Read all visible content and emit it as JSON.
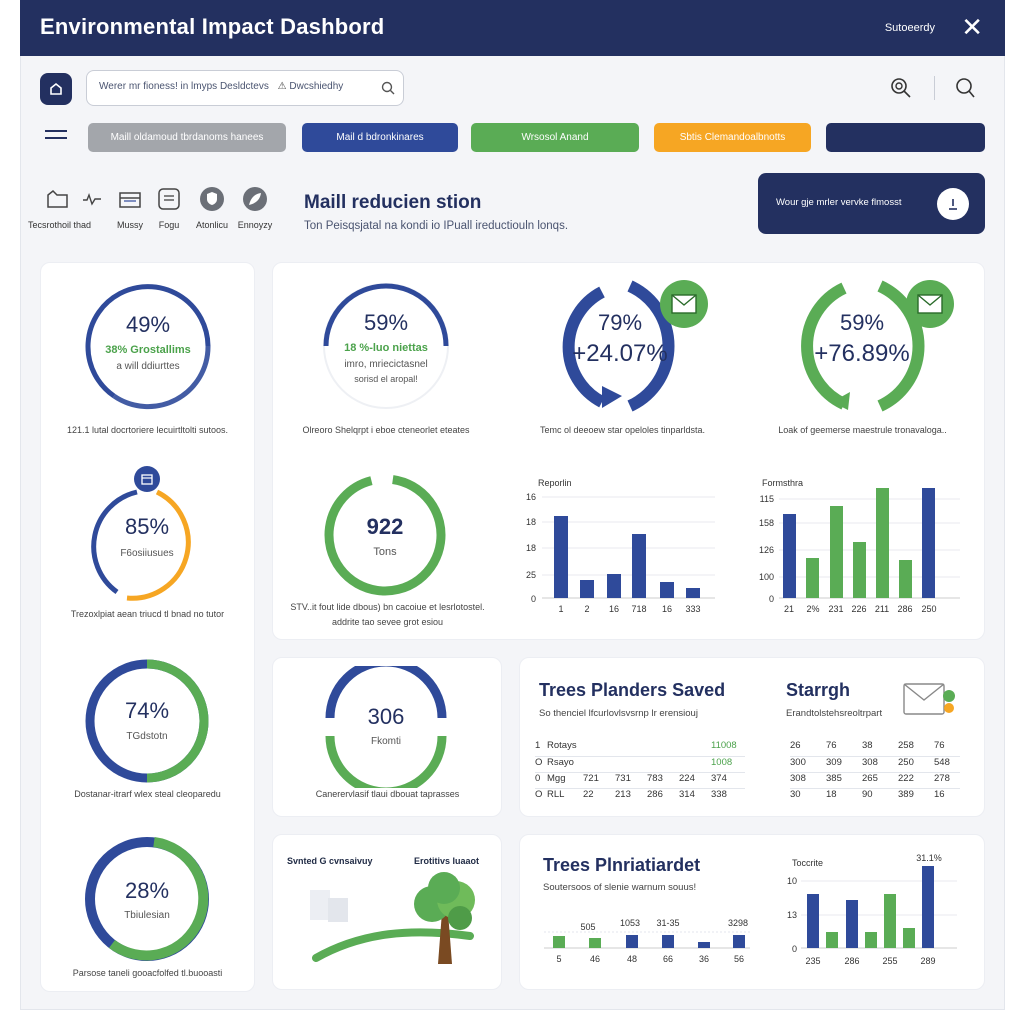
{
  "app": {
    "title": "Environmental Impact Dashbord",
    "user": "Sutoeerdy"
  },
  "search": {
    "text": "Werer mr fioness! in lmyps Desldctevs",
    "hint": "Dwcshiedhy"
  },
  "colors": {
    "navy": "#233060",
    "blue": "#2f4a9a",
    "green": "#5aac55",
    "orange": "#f6a623",
    "gray": "#a3a6ab"
  },
  "chips": [
    {
      "label": "Maill oldamoud tbrdanoms hanees",
      "color": "#a3a6ab"
    },
    {
      "label": "Mail d bdronkinares",
      "color": "#2f4a9a"
    },
    {
      "label": "Wrsosol Anand",
      "color": "#5aac55"
    },
    {
      "label": "Sbtis Clemandoalbnotts",
      "color": "#f6a623"
    },
    {
      "label": "",
      "color": "#233060"
    }
  ],
  "quick": [
    {
      "label": "Tecsrothoil thad",
      "icon": "folder-icon"
    },
    {
      "label": "Mussy",
      "icon": "wave-icon"
    },
    {
      "label": "Fogu",
      "icon": "calendar-icon"
    },
    {
      "label": "Atonlicu",
      "icon": "shield-icon"
    },
    {
      "label": "Ennoyzy",
      "icon": "leaf-icon"
    }
  ],
  "section": {
    "title": "Maill reducien stion",
    "subtitle": "Ton Peisqsjatal na kondi io IPuall ireductiouln lonqs."
  },
  "forecast": {
    "label": "Wour gje mrler vervke flmosst"
  },
  "gauges": {
    "g1": {
      "value": "49%",
      "sub1": "38% Grostallims",
      "sub2": "a will ddiurttes",
      "caption": "121.1 lutal docrtoriere lecuirtltolti sutoos."
    },
    "g2": {
      "value": "59%",
      "sub1": "18 %-luo niettas",
      "sub2": "imro, mriecictasnel",
      "sub3": "sorisd el aropal!",
      "caption": "Olreoro Shelqrpt i eboe cteneorlet eteates"
    },
    "g3": {
      "value": "79%",
      "sub1": "+24.07%",
      "caption": "Temc ol deeoew star opeloles tinparldsta."
    },
    "g4": {
      "value": "59%",
      "sub1": "+76.89%",
      "caption": "Loak of geemerse maestrule tronavaloga.."
    },
    "g5": {
      "value": "85%",
      "sub1": "F6osiiusues",
      "caption": "Trezoxlpiat aean triucd tl bnad no tutor",
      "fill": 0.85
    },
    "g6": {
      "value": "922",
      "sub1": "Tons",
      "caption1": "STV..it fout lide dbous) bn cacoiue et lesrlotostel.",
      "caption2": "addrite tao sevee grot esiou"
    },
    "g7": {
      "value": "74%",
      "sub1": "TGdstotn",
      "caption": "Dostanar-itrarf wlex steal cleoparedu"
    },
    "g8": {
      "value": "306",
      "sub1": "Fkomti",
      "caption": "Canerervlasif tlaui dbouat taprasses"
    },
    "g9": {
      "value": "28%",
      "sub1": "Tbiulesian",
      "caption": "Parsose taneli gooacfolfed tl.buooasti"
    }
  },
  "bar1": {
    "title": "Reporlin",
    "yticks": [
      "16",
      "18",
      "18",
      "25",
      "0"
    ],
    "xticks": [
      "1",
      "2",
      "16",
      "718",
      "16",
      "333"
    ]
  },
  "bar2": {
    "title": "Formsthra",
    "yticks": [
      "115",
      "158",
      "126",
      "100",
      "0"
    ],
    "xticks": [
      "21",
      "2%",
      "231",
      "226",
      "211",
      "286",
      "250"
    ]
  },
  "trees_card": {
    "title": "Trees Planders Saved",
    "subtitle": "So thenciel lfcurlovlsvsrnp lr erensiouj",
    "rows": [
      {
        "a": "1",
        "b": "Rotays",
        "c": "",
        "d": "",
        "e": "",
        "f": "",
        "g": "11008"
      },
      {
        "a": "O",
        "b": "Rsayo",
        "c": "",
        "d": "",
        "e": "",
        "f": "",
        "g": "1008"
      },
      {
        "a": "0",
        "b": "Mgg",
        "c": "721",
        "d": "731",
        "e": "783",
        "f": "224",
        "g": "374"
      },
      {
        "a": "O",
        "b": "RLL",
        "c": "22",
        "d": "213",
        "e": "286",
        "f": "314",
        "g": "338"
      }
    ]
  },
  "strength": {
    "title": "Starrgh",
    "subtitle": "Erandtolstehsreoltrpart",
    "rows": [
      [
        "26",
        "76",
        "38",
        "258",
        "76"
      ],
      [
        "300",
        "309",
        "308",
        "250",
        "548"
      ],
      [
        "308",
        "385",
        "265",
        "222",
        "278"
      ],
      [
        "30",
        "18",
        "90",
        "389",
        "16"
      ]
    ]
  },
  "growth": {
    "left": "Svnted G cvnsaivuy",
    "right": "Erotitivs Iuaaot"
  },
  "trees2": {
    "title": "Trees Plnriatiardet",
    "subtitle": "Soutersoos of slenie warnum souus!",
    "top": [
      "505",
      "1053",
      "31-35",
      "3298"
    ],
    "xticks": [
      "5",
      "46",
      "48",
      "66",
      "36",
      "56"
    ]
  },
  "bar3": {
    "title": "Toccrite",
    "top": "31.1%",
    "yticks": [
      "10",
      "13",
      "0"
    ],
    "xticks": [
      "235",
      "286",
      "255",
      "289"
    ]
  }
}
